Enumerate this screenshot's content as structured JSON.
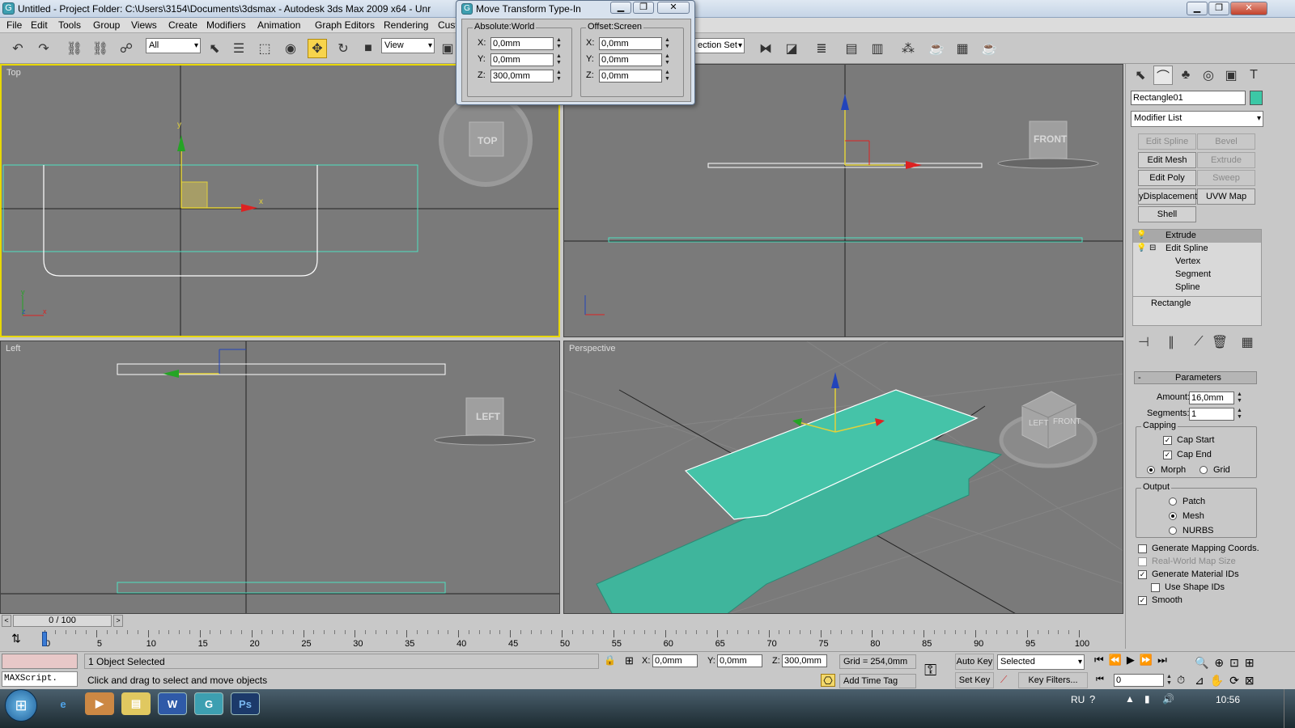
{
  "window": {
    "title": "Untitled     - Project Folder: C:\\Users\\3154\\Documents\\3dsmax     - Autodesk 3ds Max  2009 x64  - Unr",
    "icon": "3dsmax-icon"
  },
  "menu": [
    "File",
    "Edit",
    "Tools",
    "Group",
    "Views",
    "Create",
    "Modifiers",
    "Animation",
    "Graph Editors",
    "Rendering",
    "Custo"
  ],
  "toolbar": {
    "filter_dropdown": "All",
    "refcoord_dropdown": "View",
    "selection_set": "ection Set"
  },
  "dialog": {
    "title": "Move Transform Type-In",
    "absolute": {
      "label": "Absolute:World",
      "x": "0,0mm",
      "y": "0,0mm",
      "z": "300,0mm"
    },
    "offset": {
      "label": "Offset:Screen",
      "x": "0,0mm",
      "y": "0,0mm",
      "z": "0,0mm"
    },
    "axis_labels": {
      "x": "X:",
      "y": "Y:",
      "z": "Z:"
    }
  },
  "viewports": {
    "top": {
      "label": "Top",
      "cube": "TOP"
    },
    "front": {
      "label": "",
      "cube": "FRONT"
    },
    "left": {
      "label": "Left",
      "cube": "LEFT"
    },
    "perspective": {
      "label": "Perspective",
      "cube_left": "LEFT",
      "cube_front": "FRONT"
    },
    "axis": {
      "x": "x",
      "y": "y",
      "z": "z"
    }
  },
  "command_panel": {
    "object_name": "Rectangle01",
    "object_color": "#3cc8a6",
    "modifier_list": "Modifier List",
    "buttons": [
      {
        "label": "Edit Spline",
        "enabled": false
      },
      {
        "label": "Bevel",
        "enabled": false
      },
      {
        "label": "Edit Mesh",
        "enabled": true
      },
      {
        "label": "Extrude",
        "enabled": false
      },
      {
        "label": "Edit Poly",
        "enabled": true
      },
      {
        "label": "Sweep",
        "enabled": false
      },
      {
        "label": "yDisplacement",
        "enabled": true
      },
      {
        "label": "UVW Map",
        "enabled": true
      },
      {
        "label": "Shell",
        "enabled": true
      }
    ],
    "stack": [
      {
        "label": "Extrude",
        "level": 0,
        "selected": true
      },
      {
        "label": "Edit Spline",
        "level": 0,
        "selected": false
      },
      {
        "label": "Vertex",
        "level": 1,
        "selected": false
      },
      {
        "label": "Segment",
        "level": 1,
        "selected": false
      },
      {
        "label": "Spline",
        "level": 1,
        "selected": false
      },
      {
        "label": "Rectangle",
        "level": -1,
        "selected": false
      }
    ],
    "parameters": {
      "title": "Parameters",
      "collapse": "-",
      "amount_label": "Amount:",
      "amount": "16,0mm",
      "segments_label": "Segments:",
      "segments": "1",
      "capping_label": "Capping",
      "cap_start": "Cap Start",
      "cap_end": "Cap End",
      "morph": "Morph",
      "grid": "Grid",
      "output_label": "Output",
      "patch": "Patch",
      "mesh": "Mesh",
      "nurbs": "NURBS",
      "gen_mapping": "Generate Mapping Coords.",
      "real_world": "Real-World Map Size",
      "gen_matids": "Generate Material IDs",
      "use_shape_ids": "Use Shape IDs",
      "smooth": "Smooth"
    }
  },
  "timeline": {
    "frame_counter": "0 / 100",
    "ticks": [
      "0",
      "5",
      "10",
      "15",
      "20",
      "25",
      "30",
      "35",
      "40",
      "45",
      "50",
      "55",
      "60",
      "65",
      "70",
      "75",
      "80",
      "85",
      "90",
      "95",
      "100"
    ]
  },
  "status": {
    "selection": "1 Object Selected",
    "prompt": "Click and drag to select and move objects",
    "maxscript": "MAXScript.",
    "x_label": "X:",
    "x": "0,0mm",
    "y_label": "Y:",
    "y": "0,0mm",
    "z_label": "Z:",
    "z": "300,0mm",
    "grid": "Grid = 254,0mm",
    "add_time_tag": "Add Time Tag",
    "auto_key": "Auto Key",
    "set_key": "Set Key",
    "selected": "Selected",
    "key_filters": "Key Filters...",
    "frame": "0"
  },
  "taskbar": {
    "lang": "RU",
    "time": "10:56"
  }
}
